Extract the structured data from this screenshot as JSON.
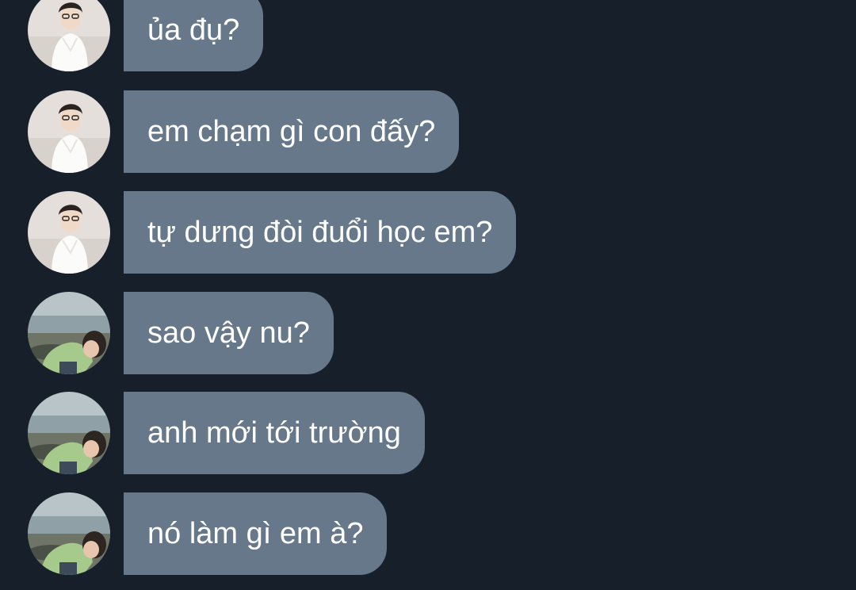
{
  "conversation": {
    "messages": [
      {
        "sender": "girl",
        "avatar_icon": "girl-avatar-icon",
        "text": "ủa đụ?"
      },
      {
        "sender": "girl",
        "avatar_icon": "girl-avatar-icon",
        "text": "em chạm gì con đấy?"
      },
      {
        "sender": "girl",
        "avatar_icon": "girl-avatar-icon",
        "text": "tự dưng đòi đuổi học em?"
      },
      {
        "sender": "boy",
        "avatar_icon": "boy-avatar-icon",
        "text": "sao vậy nu?"
      },
      {
        "sender": "boy",
        "avatar_icon": "boy-avatar-icon",
        "text": "anh mới tới trường"
      },
      {
        "sender": "boy",
        "avatar_icon": "boy-avatar-icon",
        "text": "nó làm gì em à?"
      }
    ]
  },
  "colors": {
    "background": "#17202a",
    "bubble": "#66788a",
    "text": "#ffffff"
  }
}
